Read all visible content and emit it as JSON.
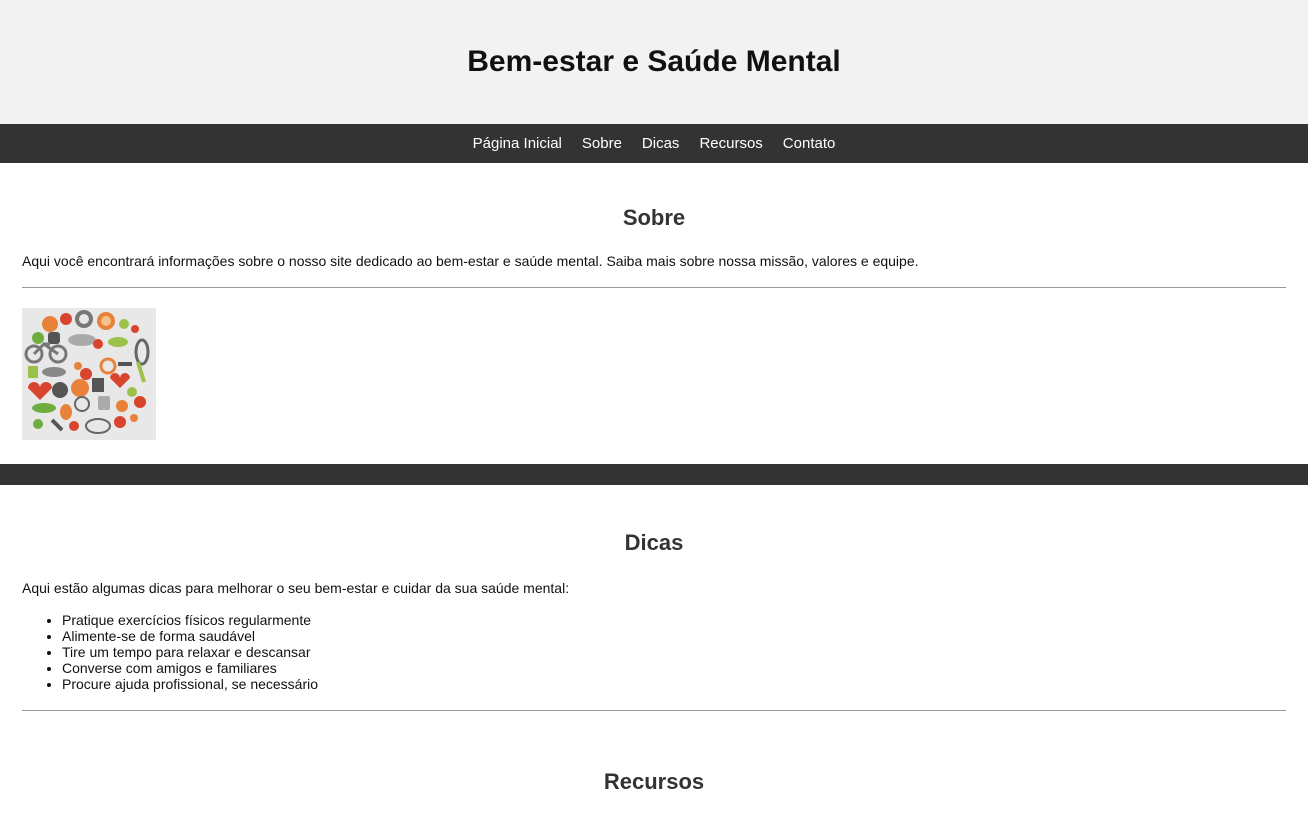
{
  "header": {
    "title": "Bem-estar e Saúde Mental"
  },
  "nav": {
    "items": [
      {
        "label": "Página Inicial"
      },
      {
        "label": "Sobre"
      },
      {
        "label": "Dicas"
      },
      {
        "label": "Recursos"
      },
      {
        "label": "Contato"
      }
    ]
  },
  "sobre": {
    "heading": "Sobre",
    "text": "Aqui você encontrará informações sobre o nosso site dedicado ao bem-estar e saúde mental. Saiba mais sobre nossa missão, valores e equipe.",
    "image_icon": "health-icons-collage"
  },
  "dicas": {
    "heading": "Dicas",
    "intro": "Aqui estão algumas dicas para melhorar o seu bem-estar e cuidar da sua saúde mental:",
    "items": [
      "Pratique exercícios físicos regularmente",
      "Alimente-se de forma saudável",
      "Tire um tempo para relaxar e descansar",
      "Converse com amigos e familiares",
      "Procure ajuda profissional, se necessário"
    ]
  },
  "recursos": {
    "heading": "Recursos"
  },
  "colors": {
    "header_bg": "#f2f2f2",
    "nav_bg": "#333333",
    "nav_text": "#ffffff"
  }
}
